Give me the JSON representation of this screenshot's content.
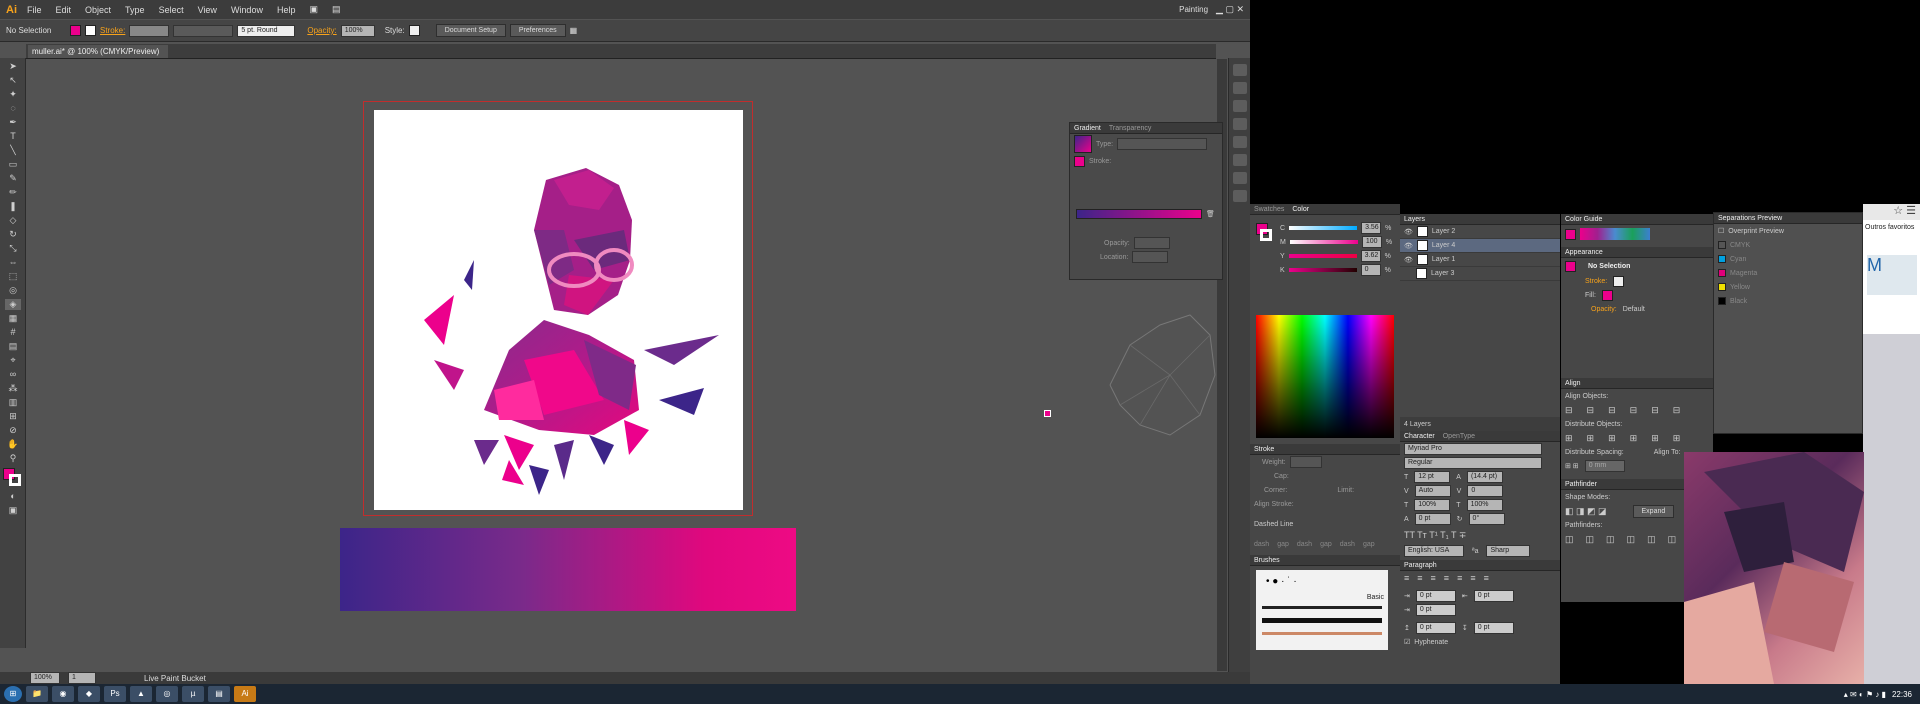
{
  "app": {
    "logo": "Ai",
    "workspace": "Painting"
  },
  "menu": [
    "File",
    "Edit",
    "Object",
    "Type",
    "Select",
    "View",
    "Window",
    "Help"
  ],
  "control": {
    "selection": "No Selection",
    "stroke_label": "Stroke:",
    "brush": "5 pt. Round",
    "opacity_label": "Opacity:",
    "opacity": "100%",
    "style_label": "Style:",
    "doc_setup": "Document Setup",
    "preferences": "Preferences"
  },
  "doc": {
    "tab": "muller.ai* @ 100% (CMYK/Preview)"
  },
  "status": {
    "zoom": "100%",
    "page": "1",
    "tool": "Live Paint Bucket"
  },
  "gradient": {
    "tabs": [
      "Gradient",
      "Transparency"
    ],
    "type_label": "Type:",
    "stroke_label": "Stroke:",
    "opacity_label": "Opacity:",
    "location_label": "Location:"
  },
  "color": {
    "tabs": [
      "Swatches",
      "Color"
    ],
    "rows": [
      {
        "k": "C",
        "v": "3.56"
      },
      {
        "k": "M",
        "v": "100"
      },
      {
        "k": "Y",
        "v": "3.62"
      },
      {
        "k": "K",
        "v": "0"
      }
    ],
    "unit": "%"
  },
  "stroke": {
    "title": "Stroke",
    "weight_label": "Weight:",
    "cap_label": "Cap:",
    "corner_label": "Corner:",
    "limit_label": "Limit:",
    "align_label": "Align Stroke:",
    "dashed": "Dashed Line",
    "dash_labels": [
      "dash",
      "gap",
      "dash",
      "gap",
      "dash",
      "gap"
    ]
  },
  "brushes": {
    "title": "Brushes",
    "basic": "Basic"
  },
  "layers": {
    "title": "Layers",
    "items": [
      "Layer 2",
      "Layer 4",
      "Layer 1",
      "Layer 3"
    ],
    "count": "4 Layers"
  },
  "character": {
    "tabs": [
      "Character",
      "OpenType"
    ],
    "font": "Myriad Pro",
    "style": "Regular",
    "size": "12 pt",
    "leading": "(14.4 pt)",
    "kern": "Auto",
    "track": "0",
    "hscale": "100%",
    "vscale": "100%",
    "baseline": "0 pt",
    "rotate": "0°",
    "lang": "English: USA",
    "aa": "Sharp"
  },
  "paragraph": {
    "title": "Paragraph",
    "indent": "0 pt",
    "hyphenate": "Hyphenate"
  },
  "colorguide": {
    "title": "Color Guide"
  },
  "appearance": {
    "title": "Appearance",
    "selection": "No Selection",
    "stroke": "Stroke:",
    "fill": "Fill:",
    "opacity": "Opacity:",
    "opacity_val": "Default"
  },
  "align": {
    "title": "Align",
    "objects": "Align Objects:",
    "distribute": "Distribute Objects:",
    "spacing": "Distribute Spacing:",
    "align_to": "Align To:",
    "spacing_val": "0 mm"
  },
  "pathfinder": {
    "title": "Pathfinder",
    "shape_modes": "Shape Modes:",
    "expand": "Expand",
    "pathfinders": "Pathfinders:"
  },
  "separations": {
    "title": "Separations Preview",
    "overprint": "Overprint Preview",
    "inks": [
      {
        "name": "CMYK",
        "color": "#555555"
      },
      {
        "name": "Cyan",
        "color": "#00a0e0"
      },
      {
        "name": "Magenta",
        "color": "#e0007a"
      },
      {
        "name": "Yellow",
        "color": "#f0e000"
      },
      {
        "name": "Black",
        "color": "#000000"
      }
    ]
  },
  "browser": {
    "bookmarks": "Outros favoritos"
  },
  "taskbar": {
    "time": "22:36"
  },
  "colors": {
    "accent": "#ec008c",
    "orange": "#f7a21b"
  }
}
